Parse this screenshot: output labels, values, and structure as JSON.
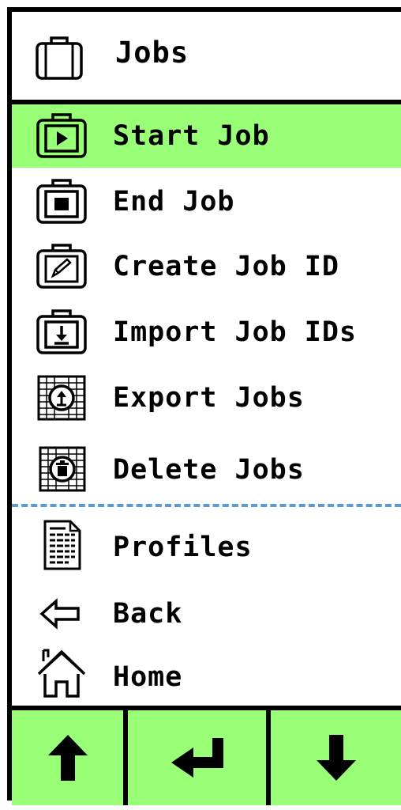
{
  "header": {
    "title": "Jobs",
    "icon": "briefcase-icon"
  },
  "menu": {
    "items": [
      {
        "label": "Start Job",
        "icon": "briefcase-play-icon",
        "selected": true
      },
      {
        "label": "End Job",
        "icon": "briefcase-stop-icon",
        "selected": false
      },
      {
        "label": "Create Job ID",
        "icon": "briefcase-edit-icon",
        "selected": false
      },
      {
        "label": "Import Job IDs",
        "icon": "briefcase-import-icon",
        "selected": false
      },
      {
        "label": "Export Jobs",
        "icon": "export-icon",
        "selected": false
      },
      {
        "label": "Delete Jobs",
        "icon": "delete-icon",
        "selected": false
      },
      {
        "label": "Profiles",
        "icon": "document-icon",
        "selected": false
      },
      {
        "label": "Back",
        "icon": "back-arrow-icon",
        "selected": false
      },
      {
        "label": "Home",
        "icon": "home-icon",
        "selected": false
      }
    ]
  },
  "controls": {
    "up": {
      "icon": "arrow-up-icon"
    },
    "enter": {
      "icon": "enter-icon"
    },
    "down": {
      "icon": "arrow-down-icon"
    }
  },
  "colors": {
    "accent": "#99ff77",
    "divider": "#5b9bd5",
    "border": "#000000"
  }
}
